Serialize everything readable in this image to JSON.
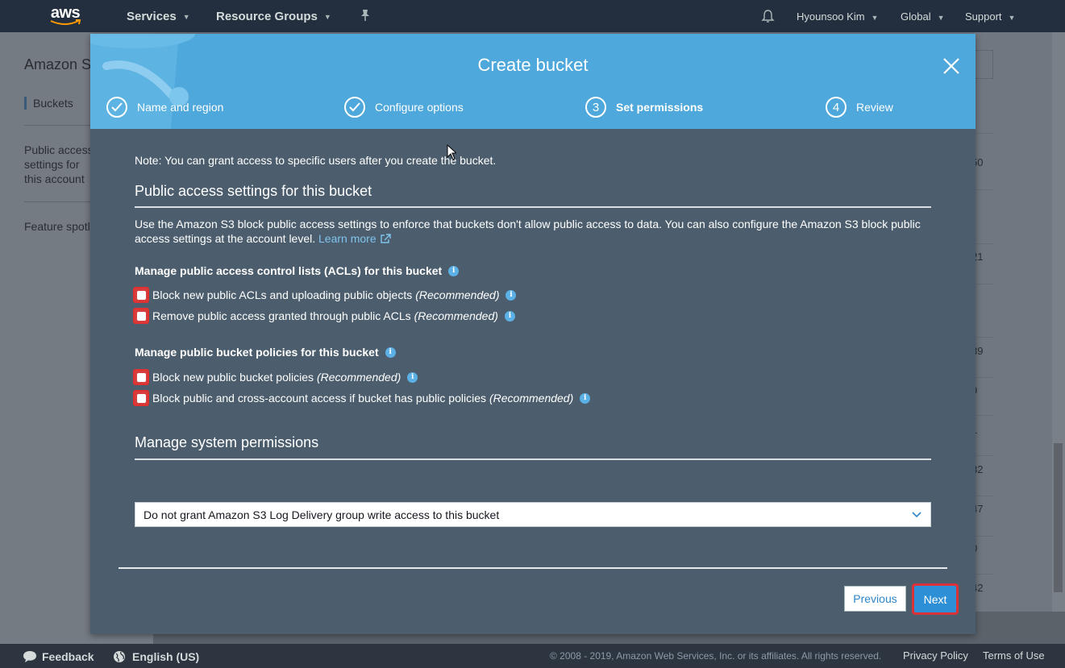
{
  "topnav": {
    "logo": "aws",
    "services": "Services",
    "resource_groups": "Resource Groups",
    "user": "Hyounsoo Kim",
    "region": "Global",
    "support": "Support"
  },
  "background": {
    "title": "Amazon S",
    "buckets": "Buckets",
    "public_access": "Public access settings for this account",
    "feature": "Feature spotl",
    "numbers": [
      "50",
      "21",
      "39",
      "9",
      "1",
      "32",
      "47",
      "0",
      "42"
    ]
  },
  "modal": {
    "title": "Create bucket",
    "steps": [
      {
        "num": "",
        "label": "Name and region"
      },
      {
        "num": "",
        "label": "Configure options"
      },
      {
        "num": "3",
        "label": "Set permissions"
      },
      {
        "num": "4",
        "label": "Review"
      }
    ],
    "note": "Note: You can grant access to specific users after you create the bucket.",
    "public_access_heading": "Public access settings for this bucket",
    "description": "Use the Amazon S3 block public access settings to enforce that buckets don't allow public access to data. You can also configure the Amazon S3 block public access settings at the account level.",
    "learn_more": "Learn more",
    "acl_heading": "Manage public access control lists (ACLs) for this bucket",
    "acl_options": [
      {
        "label": "Block new public ACLs and uploading public objects",
        "rec": "(Recommended)"
      },
      {
        "label": "Remove public access granted through public ACLs",
        "rec": "(Recommended)"
      }
    ],
    "policy_heading": "Manage public bucket policies for this bucket",
    "policy_options": [
      {
        "label": "Block new public bucket policies",
        "rec": "(Recommended)"
      },
      {
        "label": "Block public and cross-account access if bucket has public policies",
        "rec": "(Recommended)"
      }
    ],
    "system_heading": "Manage system permissions",
    "system_select": "Do not grant Amazon S3 Log Delivery group write access to this bucket",
    "previous": "Previous",
    "next": "Next"
  },
  "footer": {
    "feedback": "Feedback",
    "language": "English (US)",
    "copyright": "© 2008 - 2019, Amazon Web Services, Inc. or its affiliates. All rights reserved.",
    "privacy": "Privacy Policy",
    "terms": "Terms of Use"
  },
  "colors": {
    "header_blue": "#4fa8db",
    "modal_bg": "#4c5e6d",
    "next_blue": "#2d8fd5",
    "highlight_red": "#d8333b"
  }
}
